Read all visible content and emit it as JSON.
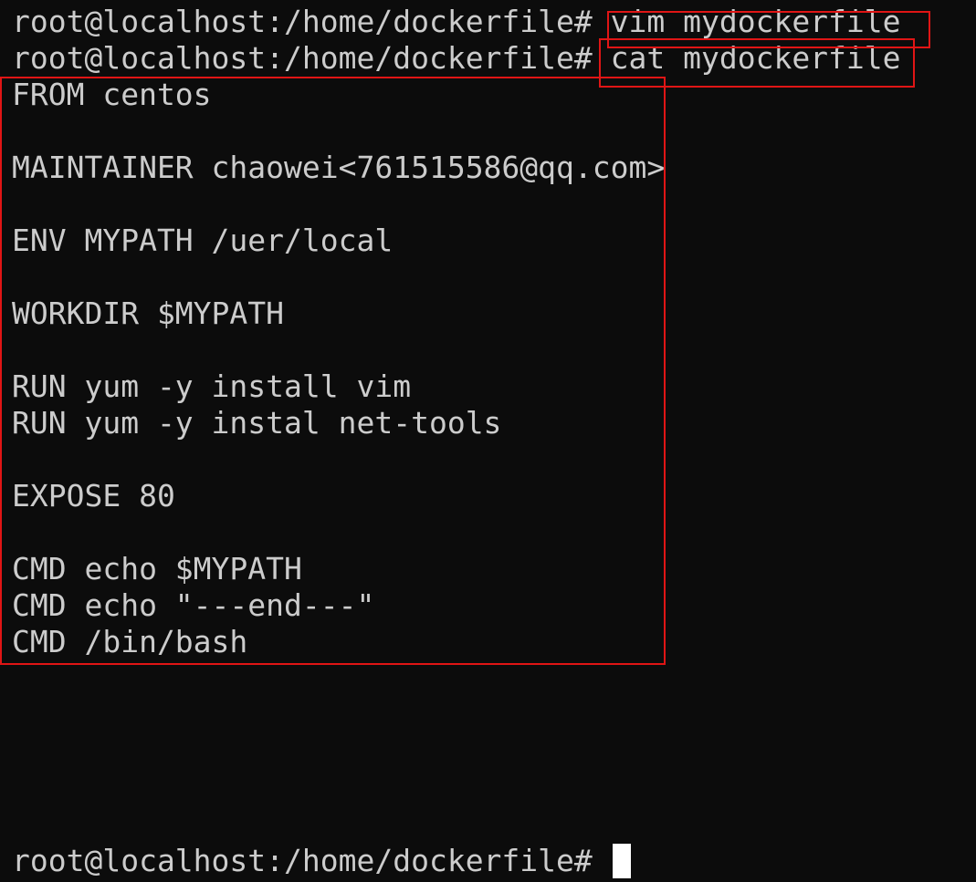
{
  "terminal": {
    "prompt": "root@localhost:/home/dockerfile#",
    "commands": {
      "first": "vim mydockerfile",
      "second": "cat mydockerfile"
    },
    "file_lines": [
      "FROM centos",
      "",
      "MAINTAINER chaowei<761515586@qq.com>",
      "",
      "ENV MYPATH /uer/local",
      "",
      "WORKDIR $MYPATH",
      "",
      "RUN yum -y install vim",
      "RUN yum -y instal net-tools",
      "",
      "EXPOSE 80",
      "",
      "CMD echo $MYPATH",
      "CMD echo \"---end---\"",
      "CMD /bin/bash"
    ]
  },
  "colors": {
    "background": "#0c0c0c",
    "text": "#cccccc",
    "annotation_box": "#e01515",
    "cursor": "#ffffff"
  }
}
